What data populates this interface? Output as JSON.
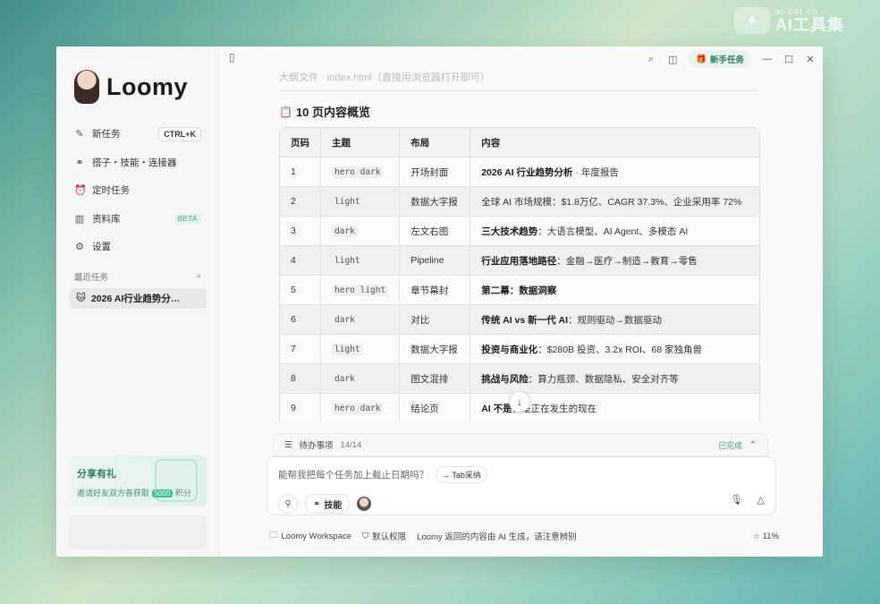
{
  "watermark": {
    "small": "ai-bot.cn",
    "big": "AI工具集"
  },
  "app": {
    "name": "Loomy"
  },
  "sidebar": {
    "items": [
      {
        "label": "新任务",
        "shortcut": "CTRL+K"
      },
      {
        "label": "搭子・技能・连接器"
      },
      {
        "label": "定时任务"
      },
      {
        "label": "资料库",
        "badge": "BETA"
      },
      {
        "label": "设置"
      }
    ],
    "recent_label": "最近任务",
    "recent_tasks": [
      {
        "label": "2026 AI行业趋势分…"
      }
    ],
    "share": {
      "title": "分享有礼",
      "desc_prefix": "邀请好友双方各获取",
      "points": "5000",
      "desc_suffix": "积分"
    }
  },
  "topbar": {
    "newbie_label": "新手任务"
  },
  "content": {
    "faded_text": "大纲文件 · index.html（直接用浏览器打开即可）",
    "section_title": "10 页内容概览",
    "table": {
      "headers": [
        "页码",
        "主题",
        "布局",
        "内容"
      ],
      "rows": [
        {
          "n": "1",
          "theme": "hero dark",
          "layout": "开场封面",
          "bold": "2026 AI 行业趋势分析",
          "rest": " · 年度报告"
        },
        {
          "n": "2",
          "theme": "light",
          "layout": "数据大字报",
          "bold": "",
          "rest": "全球 AI 市场规模：$1.8万亿、CAGR 37.3%、企业采用率 72%"
        },
        {
          "n": "3",
          "theme": "dark",
          "layout": "左文右图",
          "bold": "三大技术趋势",
          "rest": "：大语言模型、AI Agent、多模态 AI"
        },
        {
          "n": "4",
          "theme": "light",
          "layout": "Pipeline",
          "bold": "行业应用落地路径",
          "rest": "：金融→医疗→制造→教育→零售"
        },
        {
          "n": "5",
          "theme": "hero light",
          "layout": "章节幕封",
          "bold": "第二幕：数据洞察",
          "rest": ""
        },
        {
          "n": "6",
          "theme": "dark",
          "layout": "对比",
          "bold": "传统 AI vs 新一代 AI",
          "rest": "：规则驱动→数据驱动"
        },
        {
          "n": "7",
          "theme": "light",
          "layout": "数据大字报",
          "bold": "投资与商业化",
          "rest": "：$280B 投资、3.2x ROI、68 家独角兽"
        },
        {
          "n": "8",
          "theme": "dark",
          "layout": "图文混排",
          "bold": "挑战与风险",
          "rest": "：算力瓶颈、数据隐私、安全对齐等"
        },
        {
          "n": "9",
          "theme": "hero dark",
          "layout": "结论页",
          "bold": "AI 不是",
          "rest": "，是正在发生的现在"
        },
        {
          "n": "",
          "theme": "",
          "layout": "",
          "bold": "",
          "rest": ""
        }
      ]
    }
  },
  "todo": {
    "label": "待办事项",
    "count": "14/14",
    "status": "已完成"
  },
  "input": {
    "placeholder": "能帮我把每个任务加上截止日期吗？",
    "tab_accept": "Tab采纳",
    "skill_label": "技能"
  },
  "footer": {
    "workspace": "Loomy Workspace",
    "permission": "默认权限",
    "disclaimer": "Loomy 返回的内容由 AI 生成，请注意辨别",
    "progress": "11%"
  }
}
